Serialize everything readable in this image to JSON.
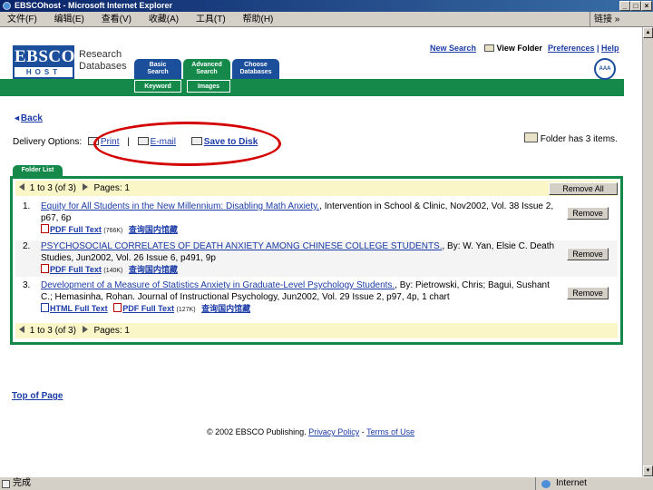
{
  "window": {
    "title": "EBSCOhost - Microsoft Internet Explorer",
    "menu": [
      "文件(F)",
      "编辑(E)",
      "查看(V)",
      "收藏(A)",
      "工具(T)",
      "帮助(H)"
    ],
    "links_label": "链接 »",
    "status_text": "完成",
    "zone": "Internet"
  },
  "header": {
    "logo_top": "EBSCO",
    "logo_bottom": "HOST",
    "product_line1": "Research",
    "product_line2": "Databases",
    "tabs": [
      {
        "line1": "Basic",
        "line2": "Search"
      },
      {
        "line1": "Advanced",
        "line2": "Search"
      },
      {
        "line1": "Choose",
        "line2": "Databases"
      }
    ],
    "subtabs": [
      "Keyword",
      "Images"
    ],
    "new_search": "New Search",
    "view_folder": "View Folder",
    "preferences": "Preferences",
    "help": "Help"
  },
  "back_label": "Back",
  "delivery": {
    "label": "Delivery Options:",
    "print": "Print",
    "sep": "|",
    "email": "E-mail",
    "save": "Save to Disk"
  },
  "folder_status": "Folder has 3 items.",
  "folder_list": {
    "tab_label": "Folder List",
    "range": "1 to 3",
    "of": "(of 3)",
    "pages": "Pages: 1",
    "remove_all": "Remove All",
    "records": [
      {
        "num": "1.",
        "title": "Equity for All Students in the New Millennium: Disabling Math Anxiety.",
        "citation": ", Intervention in School & Clinic, Nov2002, Vol. 38 Issue 2, p67, 6p",
        "links": [
          {
            "type": "pdf",
            "label": "PDF Full Text",
            "size": "(766K)"
          }
        ],
        "cn_link": "查询国内馆藏",
        "remove": "Remove"
      },
      {
        "num": "2.",
        "title": "PSYCHOSOCIAL CORRELATES OF DEATH ANXIETY AMONG CHINESE COLLEGE STUDENTS.",
        "citation": ", By: W. Yan, Elsie C. Death Studies, Jun2002, Vol. 26 Issue 6, p491, 9p",
        "links": [
          {
            "type": "pdf",
            "label": "PDF Full Text",
            "size": "(140K)"
          }
        ],
        "cn_link": "查询国内馆藏",
        "remove": "Remove"
      },
      {
        "num": "3.",
        "title": "Development of a Measure of Statistics Anxiety in Graduate-Level Psychology Students.",
        "citation": ", By: Pietrowski, Chris; Bagui, Sushant C.; Hemasinha, Rohan. Journal of Instructional Psychology, Jun2002, Vol. 29 Issue 2, p97, 4p, 1 chart",
        "links": [
          {
            "type": "html",
            "label": "HTML Full Text",
            "size": ""
          },
          {
            "type": "pdf",
            "label": "PDF Full Text",
            "size": "(127K)"
          }
        ],
        "cn_link": "查询国内馆藏",
        "remove": "Remove"
      }
    ]
  },
  "top_of_page": "Top of Page",
  "footer": {
    "copyright": "© 2002 EBSCO Publishing.",
    "privacy": "Privacy Policy",
    "dash": "-",
    "terms": "Terms of Use"
  },
  "colors": {
    "brand_blue": "#1b4e9b",
    "brand_green": "#14894a",
    "link": "#1b3ba6",
    "highlight_row": "#faf6c8",
    "annotation_circle": "#d40000"
  }
}
